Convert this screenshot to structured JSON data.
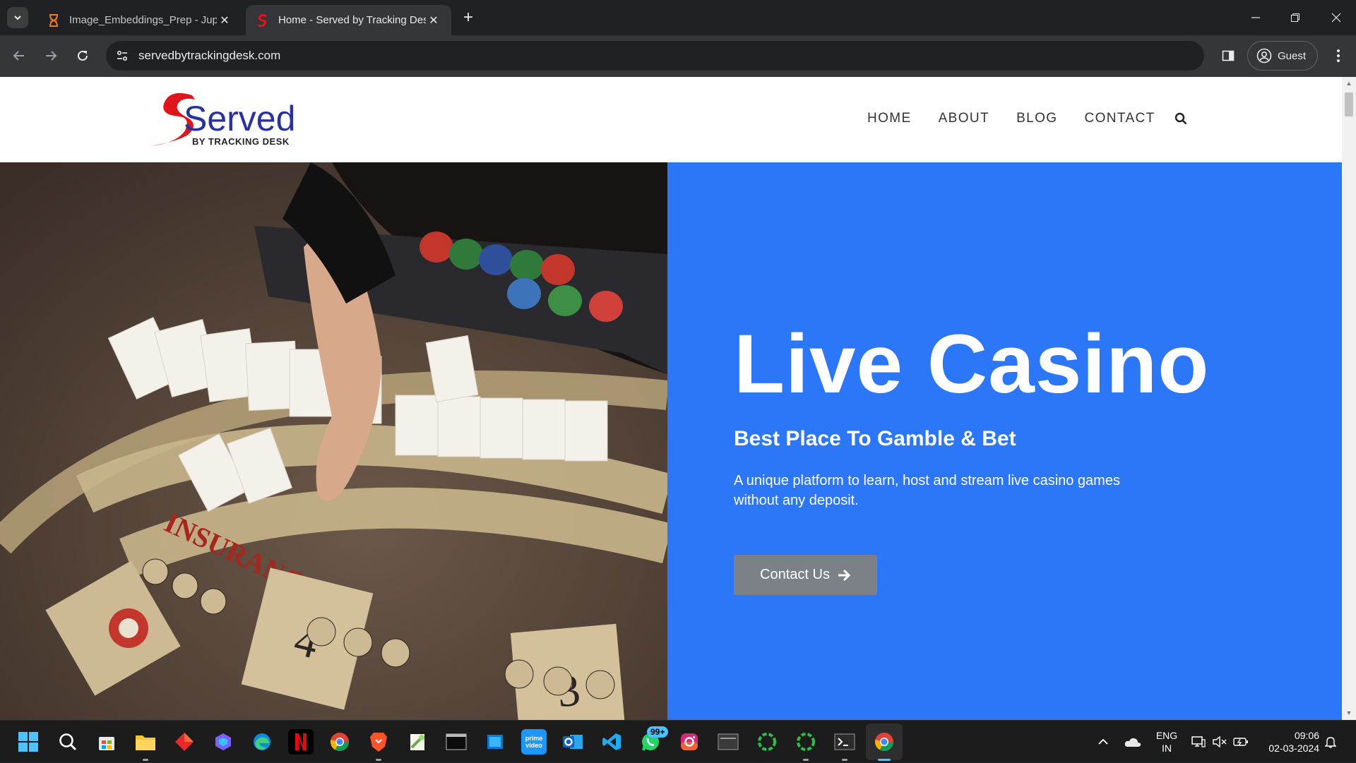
{
  "browser": {
    "tabs": [
      {
        "title": "Image_Embeddings_Prep - Jupy",
        "active": false,
        "favicon": "jupyter-hourglass-icon"
      },
      {
        "title": "Home - Served by Tracking Des",
        "active": true,
        "favicon": "served-s-icon"
      }
    ],
    "url": "servedbytrackingdesk.com",
    "profile_label": "Guest"
  },
  "site": {
    "logo_word": "Served",
    "logo_sub": "BY TRACKING DESK",
    "nav": [
      "HOME",
      "ABOUT",
      "BLOG",
      "CONTACT"
    ],
    "hero": {
      "title": "Live Casino",
      "subtitle": "Best Place To Gamble & Bet",
      "description": "A unique platform to learn, host and stream live casino games without any deposit.",
      "cta_label": "Contact Us",
      "image_table_numbers": [
        "4",
        "3"
      ]
    },
    "colors": {
      "hero_blue": "#2b77f8",
      "cta_gray": "#7c8087",
      "logo_red": "#e1141b",
      "logo_blue": "#2632a0"
    }
  },
  "taskbar": {
    "apps": [
      "windows-start-icon",
      "search-icon",
      "microsoft-store-icon",
      "file-explorer-icon",
      "app-diamond-icon",
      "copilot-icon",
      "edge-icon",
      "netflix-icon",
      "chrome-icon",
      "brave-icon",
      "notepad-plus-icon",
      "terminal-icon",
      "windows-app-icon",
      "prime-video-icon",
      "outlook-icon",
      "vscode-icon",
      "whatsapp-icon",
      "instagram-icon",
      "vm-icon",
      "spinner-icon-1",
      "spinner-icon-2",
      "powershell-icon",
      "chrome-active-icon"
    ],
    "whatsapp_badge": "99+",
    "language": [
      "ENG",
      "IN"
    ],
    "time": "09:06",
    "date": "02-03-2024"
  }
}
